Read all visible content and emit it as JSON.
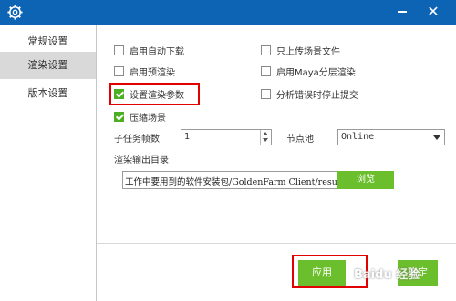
{
  "sidebar": {
    "items": [
      {
        "label": "常规设置"
      },
      {
        "label": "渲染设置"
      },
      {
        "label": "版本设置"
      }
    ]
  },
  "options": {
    "auto_download": {
      "label": "启用自动下载",
      "checked": false
    },
    "upload_scene_only": {
      "label": "只上传场景文件",
      "checked": false
    },
    "pre_render": {
      "label": "启用预渲染",
      "checked": false
    },
    "maya_layer_render": {
      "label": "启用Maya分层渲染",
      "checked": false
    },
    "set_render_params": {
      "label": "设置渲染参数",
      "checked": true
    },
    "stop_on_analysis_error": {
      "label": "分析错误时停止提交",
      "checked": false
    },
    "compress_scene": {
      "label": "压缩场景",
      "checked": true
    }
  },
  "subtask_frames": {
    "label": "子任务帧数",
    "value": "1"
  },
  "node_pool": {
    "label": "节点池",
    "value": "Online"
  },
  "output_dir": {
    "label": "渲染输出目录",
    "value": "工作中要用到的软件安装包/GoldenFarm Client/result",
    "browse_label": "浏览"
  },
  "footer": {
    "apply_label": "应用",
    "other_label": "确定"
  },
  "watermark": "Baidu 经验",
  "colors": {
    "titlebar": "#0d63b4",
    "accent_green": "#6cbf2c",
    "highlight_red": "#e30000"
  }
}
